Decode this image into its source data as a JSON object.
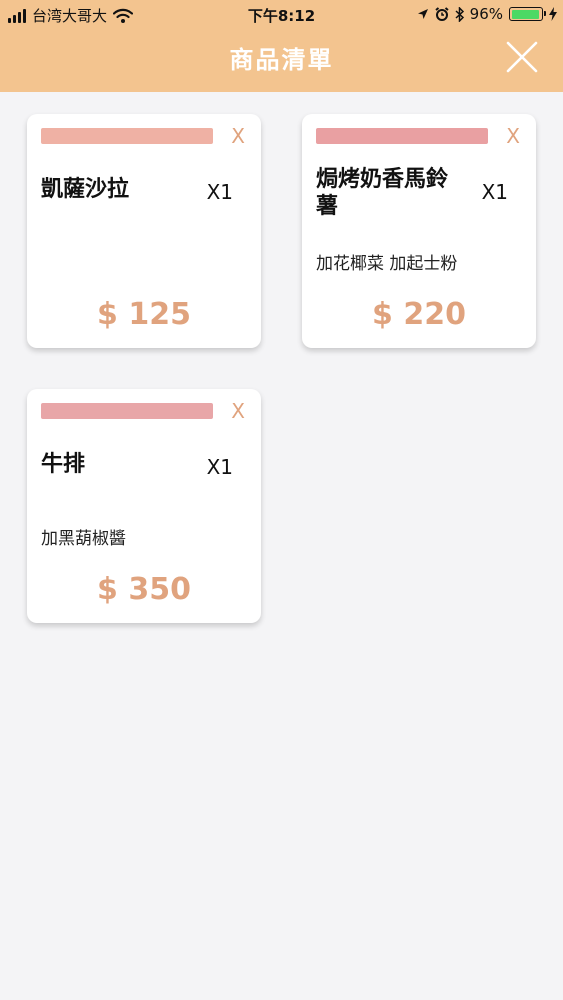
{
  "status_bar": {
    "carrier": "台湾大哥大",
    "time": "下午8:12",
    "battery": "96%",
    "battery_level": 0.96
  },
  "header": {
    "title": "商品清單",
    "close_icon": "close-icon"
  },
  "colors": {
    "header_bg": "#f3c48f",
    "accent": "#e0a37e",
    "bar_1": "#efb1a4",
    "bar_2": "#e9a0a2",
    "bar_3": "#e8a6a8"
  },
  "cards": [
    {
      "name": "凱薩沙拉",
      "qty": "X1",
      "note": "",
      "price": "$ 125",
      "remove": "X"
    },
    {
      "name": "焗烤奶香馬鈴薯",
      "qty": "X1",
      "note": "加花椰菜 加起士粉",
      "price": "$ 220",
      "remove": "X"
    },
    {
      "name": "牛排",
      "qty": "X1",
      "note": "加黑葫椒醬",
      "price": "$ 350",
      "remove": "X"
    }
  ]
}
